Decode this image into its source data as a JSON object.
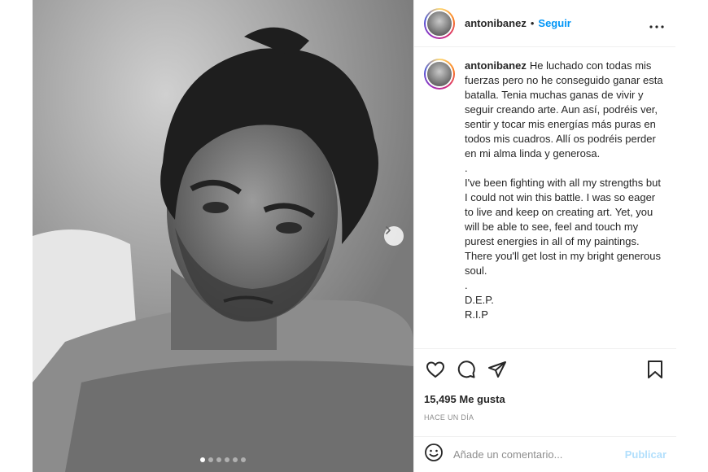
{
  "header": {
    "username": "antonibanez",
    "separator": "•",
    "follow_label": "Seguir",
    "more_icon": "more-options-icon"
  },
  "caption": {
    "username": "antonibanez",
    "lines": [
      "He luchado con todas mis fuerzas pero no he conseguido ganar esta batalla. Tenia muchas ganas de vivir y seguir creando arte. Aun así, podréis ver, sentir y tocar mis energías más puras en todos mis cuadros. Allí os podréis perder en mi alma linda y generosa.",
      ".",
      "I've been fighting with all my strengths but I could not win this battle. I was so eager to live and keep on creating art. Yet, you will be able to see, feel and touch my purest energies in all of my paintings. There you'll get lost in my bright generous soul.",
      ".",
      "D.E.P.",
      "R.I.P"
    ]
  },
  "actions": {
    "like_icon": "heart-icon",
    "comment_icon": "comment-icon",
    "share_icon": "share-icon",
    "save_icon": "bookmark-icon"
  },
  "likes": "15,495 Me gusta",
  "timestamp": "HACE UN DÍA",
  "comment": {
    "emoji_icon": "emoji-icon",
    "placeholder": "Añade un comentario...",
    "publish_label": "Publicar"
  },
  "carousel": {
    "slide_count": 6,
    "current_slide": 1,
    "next_icon": "chevron-right-icon"
  },
  "colors": {
    "accent": "#0095f6",
    "publish_disabled": "#b2dffc",
    "border": "#efefef",
    "muted": "#8e8e8e"
  }
}
